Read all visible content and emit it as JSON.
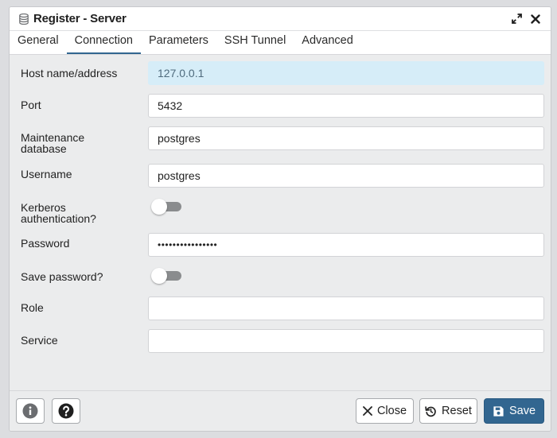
{
  "window": {
    "title": "Register - Server",
    "icons": {
      "title": "server-icon",
      "maximize": "expand-icon",
      "close": "close-icon"
    }
  },
  "tabs": [
    {
      "label": "General",
      "active": false
    },
    {
      "label": "Connection",
      "active": true
    },
    {
      "label": "Parameters",
      "active": false
    },
    {
      "label": "SSH Tunnel",
      "active": false
    },
    {
      "label": "Advanced",
      "active": false
    }
  ],
  "form": {
    "host": {
      "label": "Host name/address",
      "value": "127.0.0.1"
    },
    "port": {
      "label": "Port",
      "value": "5432"
    },
    "maintenance_db": {
      "label_line1": "Maintenance",
      "label_line2": "database",
      "value": "postgres"
    },
    "username": {
      "label": "Username",
      "value": "postgres"
    },
    "kerberos": {
      "label_line1": "Kerberos",
      "label_line2": "authentication?",
      "checked": false
    },
    "password": {
      "label": "Password",
      "value": "••••••••••••••••"
    },
    "save_password": {
      "label": "Save password?",
      "checked": false
    },
    "role": {
      "label": "Role",
      "value": ""
    },
    "service": {
      "label": "Service",
      "value": ""
    }
  },
  "footer": {
    "close_label": "Close",
    "reset_label": "Reset",
    "save_label": "Save",
    "icons": {
      "info": "info-icon",
      "help": "help-icon",
      "close": "x-icon",
      "reset": "reset-icon",
      "save": "floppy-disk-icon"
    }
  },
  "colors": {
    "accent": "#326690",
    "host_field_bg": "#d6edf8",
    "toggle_off_track": "#8a8c8e"
  }
}
